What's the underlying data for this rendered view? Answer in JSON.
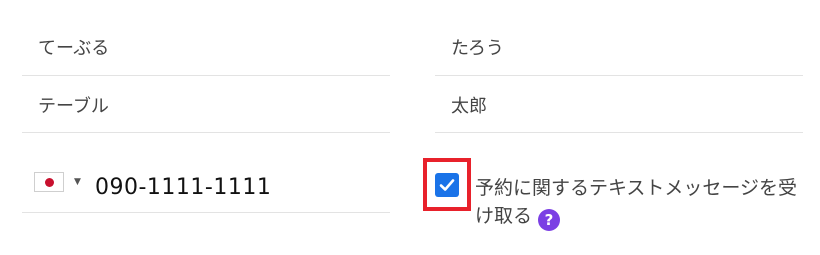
{
  "name_fields": {
    "first_name_hiragana": {
      "value": "てーぶる"
    },
    "last_name_hiragana": {
      "value": "たろう"
    },
    "first_name_katakana": {
      "value": "テーブル"
    },
    "last_name_kanji": {
      "value": "太郎"
    }
  },
  "phone": {
    "country_flag": "japan-flag-icon",
    "value": "090-1111-1111"
  },
  "sms_consent": {
    "checked": true,
    "label": "予約に関するテキストメッセージを受け取る",
    "help_symbol": "?",
    "checkbox_color": "#1a73e8",
    "highlight_color": "#e8212b",
    "help_color": "#7b3fe4"
  }
}
